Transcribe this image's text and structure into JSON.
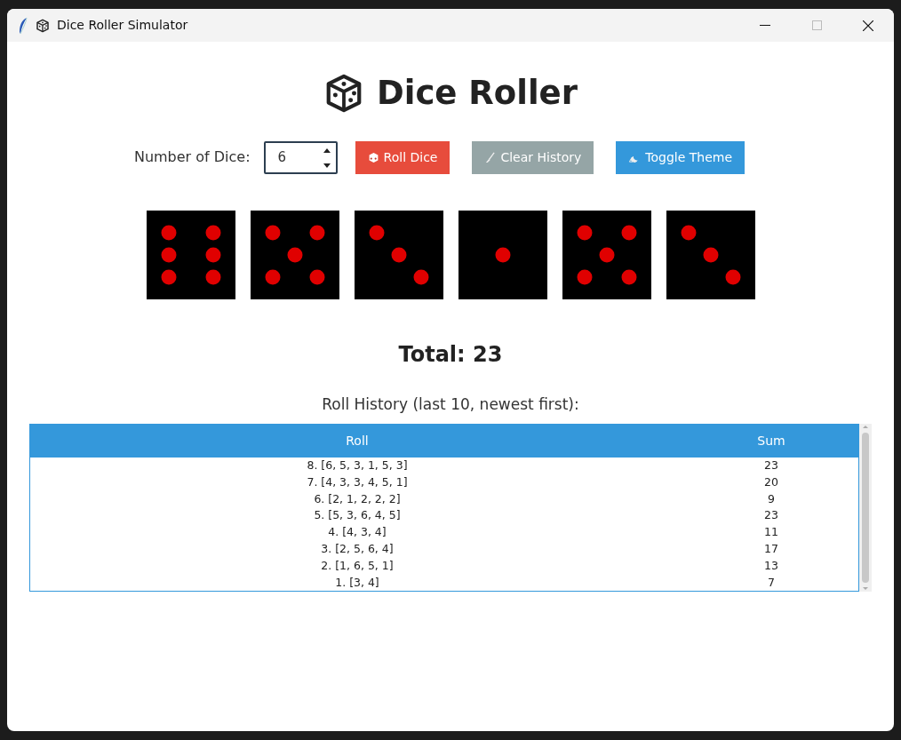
{
  "window": {
    "title": "Dice Roller Simulator"
  },
  "heading": "Dice Roller",
  "controls": {
    "label": "Number of Dice:",
    "value": "6",
    "buttons": [
      {
        "kind": "roll",
        "label": "Roll Dice",
        "color": "#e74c3c"
      },
      {
        "kind": "clear",
        "label": "Clear History",
        "color": "#95a5a6"
      },
      {
        "kind": "theme",
        "label": "Toggle Theme",
        "color": "#3498db"
      }
    ]
  },
  "dice": [
    {
      "kind": "six"
    },
    {
      "kind": "five"
    },
    {
      "kind": "three"
    },
    {
      "kind": "one"
    },
    {
      "kind": "five"
    },
    {
      "kind": "three"
    }
  ],
  "total": "Total: 23",
  "history": {
    "title": "Roll History (last 10, newest first):",
    "columns": [
      "Roll",
      "Sum"
    ],
    "rows": [
      {
        "roll": "8. [6, 5, 3, 1, 5, 3]",
        "sum": "23"
      },
      {
        "roll": "7. [4, 3, 3, 4, 5, 1]",
        "sum": "20"
      },
      {
        "roll": "6. [2, 1, 2, 2, 2]",
        "sum": "9"
      },
      {
        "roll": "5. [5, 3, 6, 4, 5]",
        "sum": "23"
      },
      {
        "roll": "4. [4, 3, 4]",
        "sum": "11"
      },
      {
        "roll": "3. [2, 5, 6, 4]",
        "sum": "17"
      },
      {
        "roll": "2. [1, 6, 5, 1]",
        "sum": "13"
      },
      {
        "roll": "1. [3, 4]",
        "sum": "7"
      }
    ]
  }
}
